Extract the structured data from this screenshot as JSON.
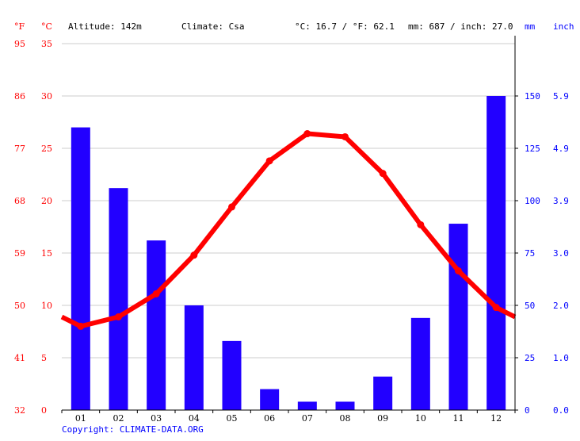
{
  "header": {
    "unit_f": "°F",
    "unit_c": "°C",
    "altitude": "Altitude: 142m",
    "climate": "Climate: Csa",
    "avg_temp": "°C: 16.7 / °F: 62.1",
    "precip_total": "mm: 687 / inch: 27.0",
    "unit_mm": "mm",
    "unit_inch": "inch"
  },
  "copyright": "Copyright: CLIMATE-DATA.ORG",
  "colors": {
    "temperature": "#ff0000",
    "precipitation": "#2200ff",
    "axis_right": "#0000ff",
    "grid": "#cccccc"
  },
  "chart_data": {
    "type": "bar+line",
    "title": "",
    "categories": [
      "01",
      "02",
      "03",
      "04",
      "05",
      "06",
      "07",
      "08",
      "09",
      "10",
      "11",
      "12"
    ],
    "series": [
      {
        "name": "Precipitation (mm)",
        "type": "bar",
        "axis": "right",
        "values": [
          135,
          106,
          81,
          50,
          33,
          10,
          4,
          4,
          16,
          44,
          89,
          150
        ]
      },
      {
        "name": "Temperature (°C)",
        "type": "line",
        "axis": "left",
        "values": [
          8.0,
          8.9,
          11.1,
          14.8,
          19.4,
          23.8,
          26.4,
          26.1,
          22.6,
          17.7,
          13.3,
          9.8
        ]
      }
    ],
    "left_axis_c": {
      "ticks": [
        "0",
        "5",
        "10",
        "15",
        "20",
        "25",
        "30",
        "35"
      ],
      "range": [
        0,
        35
      ]
    },
    "left_axis_f": {
      "ticks": [
        "32",
        "41",
        "50",
        "59",
        "68",
        "77",
        "86",
        "95"
      ]
    },
    "right_axis_mm": {
      "ticks": [
        "0",
        "25",
        "50",
        "75",
        "100",
        "125",
        "150"
      ],
      "range": [
        0,
        175
      ]
    },
    "right_axis_inch": {
      "ticks": [
        "0.0",
        "1.0",
        "2.0",
        "3.0",
        "3.9",
        "4.9",
        "5.9"
      ]
    },
    "grid": true
  }
}
